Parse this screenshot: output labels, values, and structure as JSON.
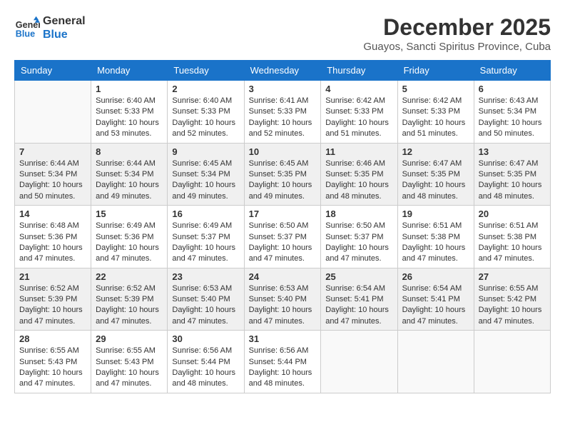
{
  "header": {
    "logo_line1": "General",
    "logo_line2": "Blue",
    "month_title": "December 2025",
    "subtitle": "Guayos, Sancti Spiritus Province, Cuba"
  },
  "weekdays": [
    "Sunday",
    "Monday",
    "Tuesday",
    "Wednesday",
    "Thursday",
    "Friday",
    "Saturday"
  ],
  "weeks": [
    [
      {
        "day": "",
        "info": ""
      },
      {
        "day": "1",
        "info": "Sunrise: 6:40 AM\nSunset: 5:33 PM\nDaylight: 10 hours\nand 53 minutes."
      },
      {
        "day": "2",
        "info": "Sunrise: 6:40 AM\nSunset: 5:33 PM\nDaylight: 10 hours\nand 52 minutes."
      },
      {
        "day": "3",
        "info": "Sunrise: 6:41 AM\nSunset: 5:33 PM\nDaylight: 10 hours\nand 52 minutes."
      },
      {
        "day": "4",
        "info": "Sunrise: 6:42 AM\nSunset: 5:33 PM\nDaylight: 10 hours\nand 51 minutes."
      },
      {
        "day": "5",
        "info": "Sunrise: 6:42 AM\nSunset: 5:33 PM\nDaylight: 10 hours\nand 51 minutes."
      },
      {
        "day": "6",
        "info": "Sunrise: 6:43 AM\nSunset: 5:34 PM\nDaylight: 10 hours\nand 50 minutes."
      }
    ],
    [
      {
        "day": "7",
        "info": "Sunrise: 6:44 AM\nSunset: 5:34 PM\nDaylight: 10 hours\nand 50 minutes."
      },
      {
        "day": "8",
        "info": "Sunrise: 6:44 AM\nSunset: 5:34 PM\nDaylight: 10 hours\nand 49 minutes."
      },
      {
        "day": "9",
        "info": "Sunrise: 6:45 AM\nSunset: 5:34 PM\nDaylight: 10 hours\nand 49 minutes."
      },
      {
        "day": "10",
        "info": "Sunrise: 6:45 AM\nSunset: 5:35 PM\nDaylight: 10 hours\nand 49 minutes."
      },
      {
        "day": "11",
        "info": "Sunrise: 6:46 AM\nSunset: 5:35 PM\nDaylight: 10 hours\nand 48 minutes."
      },
      {
        "day": "12",
        "info": "Sunrise: 6:47 AM\nSunset: 5:35 PM\nDaylight: 10 hours\nand 48 minutes."
      },
      {
        "day": "13",
        "info": "Sunrise: 6:47 AM\nSunset: 5:35 PM\nDaylight: 10 hours\nand 48 minutes."
      }
    ],
    [
      {
        "day": "14",
        "info": "Sunrise: 6:48 AM\nSunset: 5:36 PM\nDaylight: 10 hours\nand 47 minutes."
      },
      {
        "day": "15",
        "info": "Sunrise: 6:49 AM\nSunset: 5:36 PM\nDaylight: 10 hours\nand 47 minutes."
      },
      {
        "day": "16",
        "info": "Sunrise: 6:49 AM\nSunset: 5:37 PM\nDaylight: 10 hours\nand 47 minutes."
      },
      {
        "day": "17",
        "info": "Sunrise: 6:50 AM\nSunset: 5:37 PM\nDaylight: 10 hours\nand 47 minutes."
      },
      {
        "day": "18",
        "info": "Sunrise: 6:50 AM\nSunset: 5:37 PM\nDaylight: 10 hours\nand 47 minutes."
      },
      {
        "day": "19",
        "info": "Sunrise: 6:51 AM\nSunset: 5:38 PM\nDaylight: 10 hours\nand 47 minutes."
      },
      {
        "day": "20",
        "info": "Sunrise: 6:51 AM\nSunset: 5:38 PM\nDaylight: 10 hours\nand 47 minutes."
      }
    ],
    [
      {
        "day": "21",
        "info": "Sunrise: 6:52 AM\nSunset: 5:39 PM\nDaylight: 10 hours\nand 47 minutes."
      },
      {
        "day": "22",
        "info": "Sunrise: 6:52 AM\nSunset: 5:39 PM\nDaylight: 10 hours\nand 47 minutes."
      },
      {
        "day": "23",
        "info": "Sunrise: 6:53 AM\nSunset: 5:40 PM\nDaylight: 10 hours\nand 47 minutes."
      },
      {
        "day": "24",
        "info": "Sunrise: 6:53 AM\nSunset: 5:40 PM\nDaylight: 10 hours\nand 47 minutes."
      },
      {
        "day": "25",
        "info": "Sunrise: 6:54 AM\nSunset: 5:41 PM\nDaylight: 10 hours\nand 47 minutes."
      },
      {
        "day": "26",
        "info": "Sunrise: 6:54 AM\nSunset: 5:41 PM\nDaylight: 10 hours\nand 47 minutes."
      },
      {
        "day": "27",
        "info": "Sunrise: 6:55 AM\nSunset: 5:42 PM\nDaylight: 10 hours\nand 47 minutes."
      }
    ],
    [
      {
        "day": "28",
        "info": "Sunrise: 6:55 AM\nSunset: 5:43 PM\nDaylight: 10 hours\nand 47 minutes."
      },
      {
        "day": "29",
        "info": "Sunrise: 6:55 AM\nSunset: 5:43 PM\nDaylight: 10 hours\nand 47 minutes."
      },
      {
        "day": "30",
        "info": "Sunrise: 6:56 AM\nSunset: 5:44 PM\nDaylight: 10 hours\nand 48 minutes."
      },
      {
        "day": "31",
        "info": "Sunrise: 6:56 AM\nSunset: 5:44 PM\nDaylight: 10 hours\nand 48 minutes."
      },
      {
        "day": "",
        "info": ""
      },
      {
        "day": "",
        "info": ""
      },
      {
        "day": "",
        "info": ""
      }
    ]
  ]
}
